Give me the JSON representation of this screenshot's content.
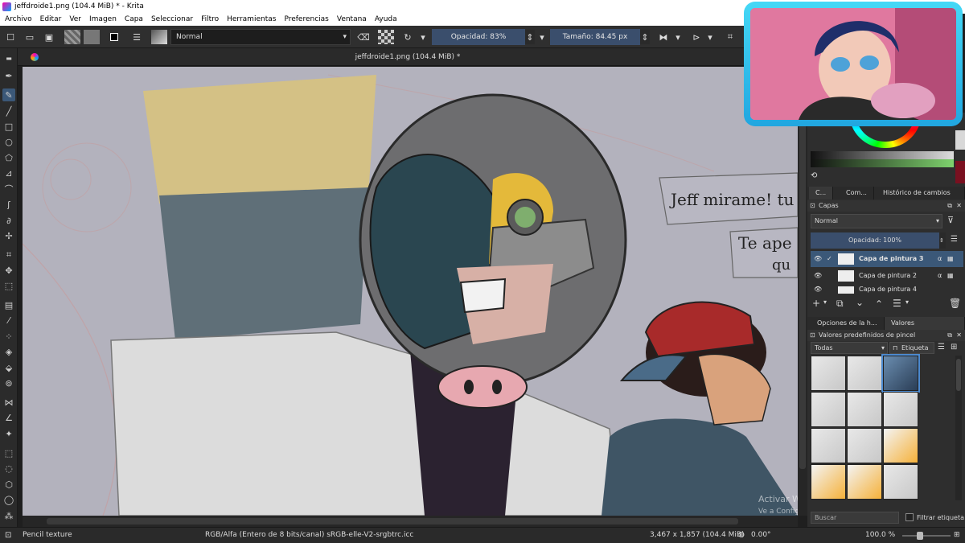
{
  "window": {
    "title": "jeffdroide1.png (104.4 MiB) * - Krita"
  },
  "menu": [
    "Archivo",
    "Editar",
    "Ver",
    "Imagen",
    "Capa",
    "Seleccionar",
    "Filtro",
    "Herramientas",
    "Preferencias",
    "Ventana",
    "Ayuda"
  ],
  "toolbar": {
    "blend_mode": "Normal",
    "opacity_label": "Opacidad: 83%",
    "opacity": 0.83,
    "size_label": "Tamaño: 84.45 px"
  },
  "document_tab": {
    "title": "jeffdroide1.png (104.4 MiB) *"
  },
  "canvas": {
    "speech1": "Jeff mirame! tu",
    "speech2": "Te ape",
    "speech2b": "qu",
    "watermark1": "Activar Windows",
    "watermark2": "Ve a Configuración para activar Windows."
  },
  "panels": {
    "tabs": [
      "C...",
      "Com...",
      "Histórico de cambios ..."
    ],
    "layers_title": "Capas",
    "layer_blend": "Normal",
    "layer_opacity": "Opacidad:  100%",
    "layers": [
      "Capa de pintura 3",
      "Capa de pintura 2",
      "Capa de pintura 4"
    ],
    "lower_tabs": [
      "Opciones de la h...",
      "Valores predefinido..."
    ],
    "presets_title": "Valores predefinidos de pincel",
    "filter_all": "Todas",
    "tag_label": "Etiqueta",
    "search_placeholder": "Buscar",
    "filter_tag_label": "Filtrar etiqueta"
  },
  "status": {
    "brush": "Pencil texture",
    "color_model": "RGB/Alfa (Entero de 8 bits/canal)  sRGB-elle-V2-srgbtrc.icc",
    "coords": "3,467 x 1,857 (104.4 MiB)",
    "rotation": "0.00°",
    "zoom": "100.0 %"
  },
  "colors": {
    "accent": "#3a5a80",
    "canvas_bg": "#b3b2bd",
    "panel_bg": "#2e2e2e"
  }
}
